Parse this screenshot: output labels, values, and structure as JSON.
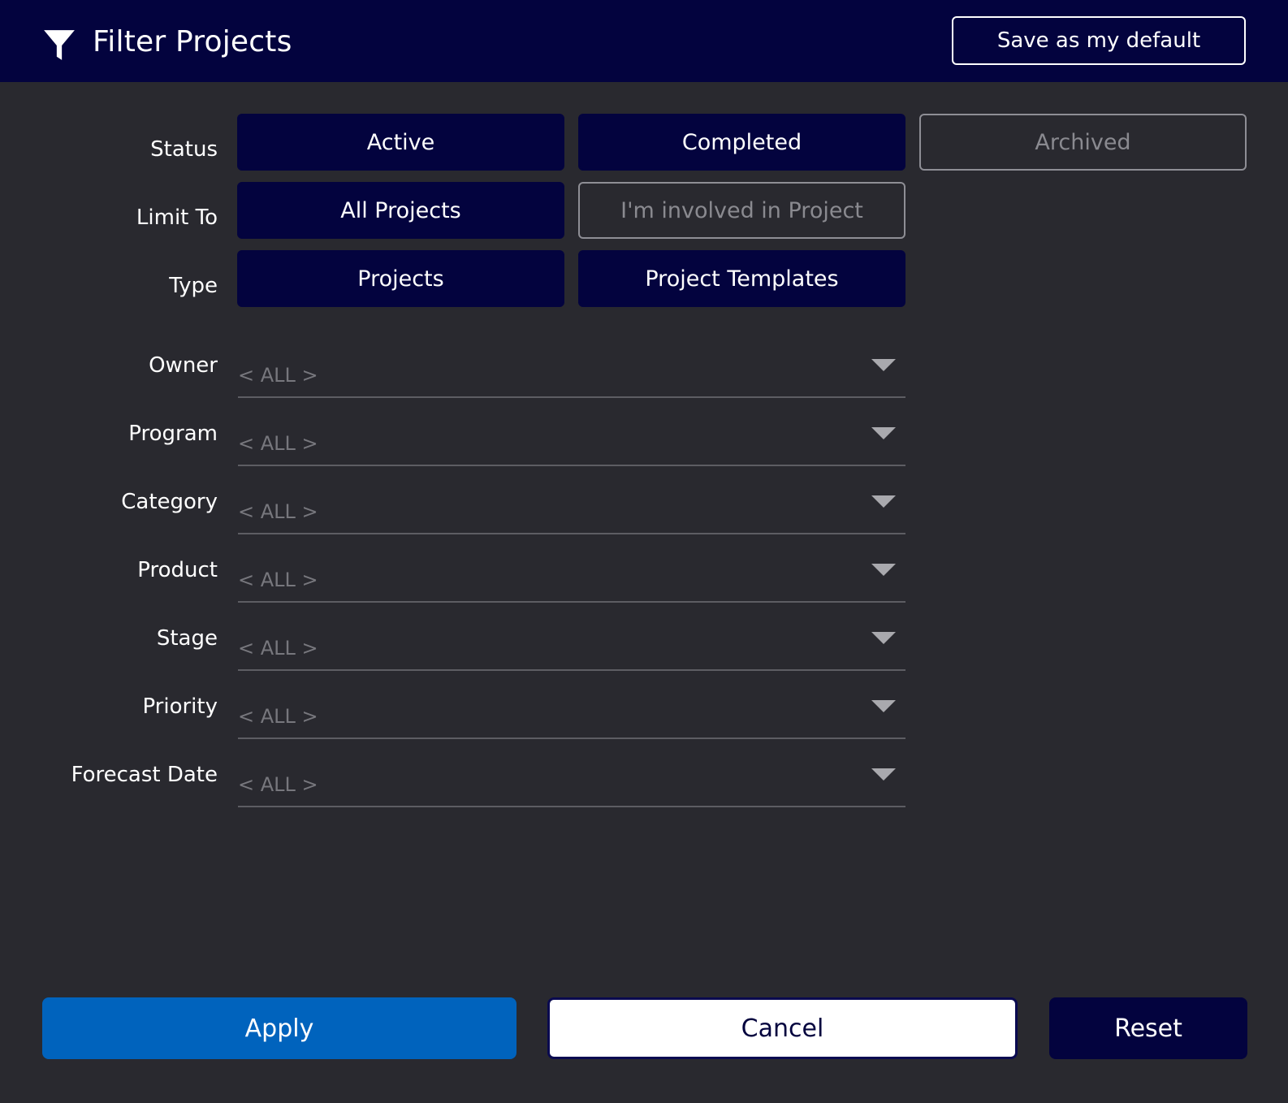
{
  "header": {
    "title": "Filter Projects",
    "icon": "funnel-icon",
    "save_default_label": "Save as my default"
  },
  "filters": {
    "status": {
      "label": "Status",
      "options": [
        {
          "label": "Active",
          "selected": true
        },
        {
          "label": "Completed",
          "selected": true
        },
        {
          "label": "Archived",
          "selected": false
        }
      ]
    },
    "limit_to": {
      "label": "Limit To",
      "options": [
        {
          "label": "All Projects",
          "selected": true
        },
        {
          "label": "I'm involved in Project",
          "selected": false
        }
      ]
    },
    "type": {
      "label": "Type",
      "options": [
        {
          "label": "Projects",
          "selected": true
        },
        {
          "label": "Project Templates",
          "selected": true
        }
      ]
    }
  },
  "dropdowns": [
    {
      "label": "Owner",
      "value": "< ALL >"
    },
    {
      "label": "Program",
      "value": "< ALL >"
    },
    {
      "label": "Category",
      "value": "< ALL >"
    },
    {
      "label": "Product",
      "value": "< ALL >"
    },
    {
      "label": "Stage",
      "value": "< ALL >"
    },
    {
      "label": "Priority",
      "value": "< ALL >"
    },
    {
      "label": "Forecast Date",
      "value": "< ALL >"
    }
  ],
  "footer": {
    "apply_label": "Apply",
    "cancel_label": "Cancel",
    "reset_label": "Reset"
  },
  "colors": {
    "header_bg": "#03033e",
    "body_bg": "#29292f",
    "apply_bg": "#0063bd",
    "selected_toggle_bg": "#03033e"
  }
}
